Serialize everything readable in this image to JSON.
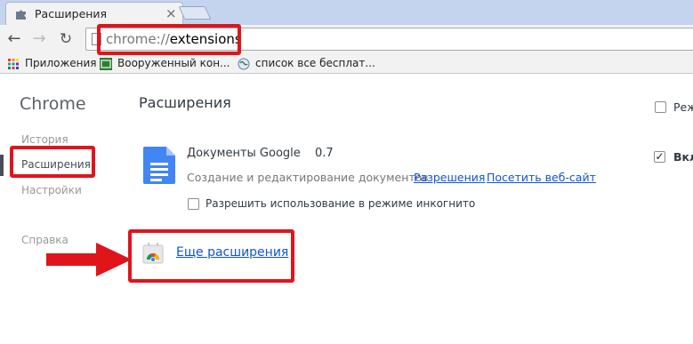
{
  "tab": {
    "title": "Расширения",
    "close_glyph": "×",
    "icon": "puzzle-icon"
  },
  "toolbar": {
    "back_glyph": "←",
    "forward_glyph": "→",
    "reload_glyph": "↻",
    "url_scheme": "chrome://",
    "url_host": "extensions"
  },
  "bookmarks": [
    {
      "label": "Приложения",
      "icon": "apps-grid-icon"
    },
    {
      "label": "Вооруженный кон...",
      "icon": "site-favicon-icon"
    },
    {
      "label": "список все бесплат...",
      "icon": "globe-icon"
    }
  ],
  "sidebar": {
    "title": "Chrome",
    "items": [
      {
        "label": "История"
      },
      {
        "label": "Расширения"
      },
      {
        "label": "Настройки"
      },
      {
        "label": "Справка"
      }
    ]
  },
  "main": {
    "title": "Расширения",
    "developer_mode_label": "Реж",
    "extension": {
      "name": "Документы Google",
      "version": "0.7",
      "description": "Создание и редактирование документов",
      "permissions_link": "Разрешения",
      "website_link": "Посетить веб-сайт",
      "incognito_label": "Разрешить использование в режиме инкогнито",
      "enabled_label": "Вкл",
      "enabled_check": "✓"
    },
    "more_extensions_link": "Еще расширения"
  },
  "colors": {
    "annotation_red": "#e0141b",
    "link_blue": "#1155cc",
    "docs_blue": "#4285f4"
  }
}
